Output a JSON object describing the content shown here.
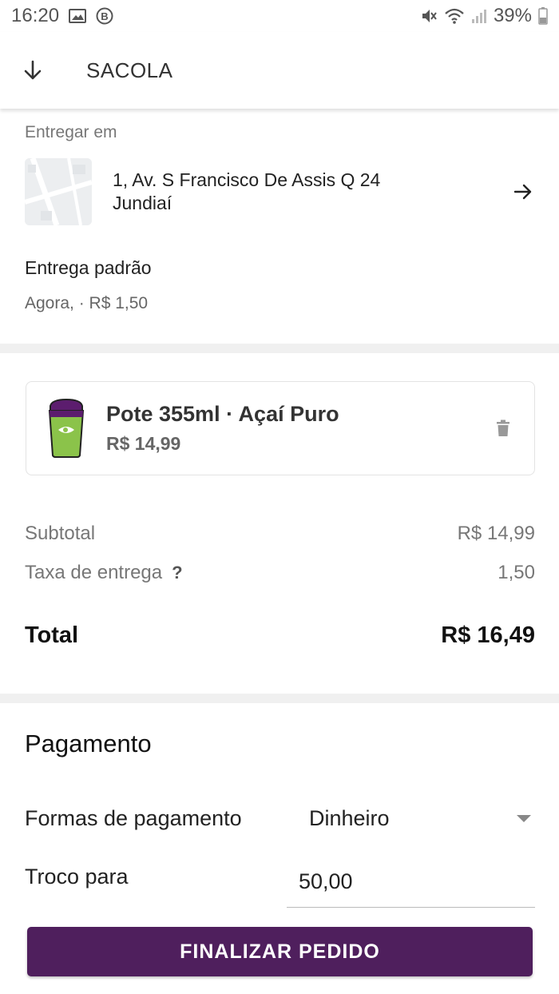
{
  "status_bar": {
    "time": "16:20",
    "battery": "39%",
    "icons": [
      "image-icon",
      "b-badge-icon",
      "mute-icon",
      "wifi-icon",
      "signal-icon",
      "battery-icon"
    ]
  },
  "app_bar": {
    "title": "SACOLA",
    "back_icon": "arrow-down-icon"
  },
  "delivery": {
    "label": "Entregar em",
    "address_line1": "1, Av. S Francisco De Assis Q 24",
    "address_line2": "Jundiaí",
    "type": "Entrega padrão",
    "eta": "Agora, · R$ 1,50"
  },
  "cart": {
    "items": [
      {
        "name": "Pote 355ml · Açaí Puro",
        "price": "R$ 14,99",
        "icon": "acai-cup-icon"
      }
    ]
  },
  "summary": {
    "subtotal_label": "Subtotal",
    "subtotal_value": "R$ 14,99",
    "fee_label": "Taxa de entrega",
    "fee_help": "?",
    "fee_value": "1,50",
    "total_label": "Total",
    "total_value": "R$ 16,49"
  },
  "payment": {
    "title": "Pagamento",
    "method_label": "Formas de pagamento",
    "method_value": "Dinheiro",
    "change_label": "Troco para",
    "change_value": "50,00"
  },
  "cta_label": "FINALIZAR PEDIDO",
  "colors": {
    "brand_purple": "#4f1f5d",
    "cup_green": "#8bc34a",
    "cup_lid": "#5c1d6e"
  }
}
